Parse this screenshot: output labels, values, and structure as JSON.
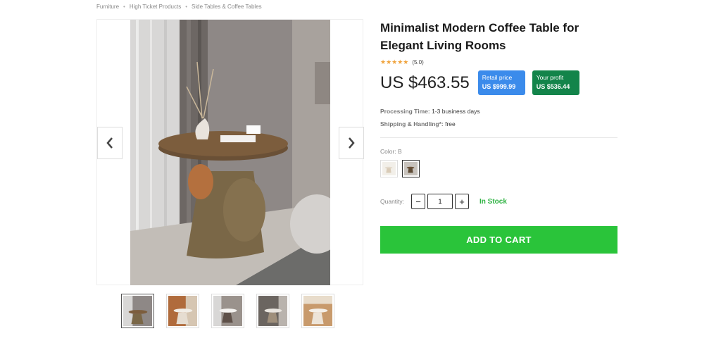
{
  "breadcrumb": [
    "Furniture",
    "High Ticket Products",
    "Side Tables & Coffee Tables"
  ],
  "product": {
    "title": "Minimalist Modern Coffee Table for Elegant Living Rooms",
    "rating_stars": "★★★★★",
    "rating_text": "(5.0)",
    "price": "US $463.55",
    "retail_label": "Retail price",
    "retail_value": "US $999.99",
    "profit_label": "Your profit",
    "profit_value": "US $536.44",
    "processing_label": "Processing Time:",
    "processing_value": "1-3 business days",
    "shipping_label": "Shipping & Handling*:",
    "shipping_value": "free",
    "color_label": "Color: B",
    "quantity_label": "Quantity:",
    "quantity_value": "1",
    "minus": "−",
    "plus": "+",
    "stock": "In Stock",
    "add_to_cart": "ADD TO CART"
  },
  "colors": {
    "accent_green": "#2ac43a",
    "retail_blue": "#3b8beb",
    "profit_green": "#13844a",
    "star": "#f0a33c"
  },
  "icons": {
    "prev": "chevron-left-icon",
    "next": "chevron-right-icon"
  }
}
